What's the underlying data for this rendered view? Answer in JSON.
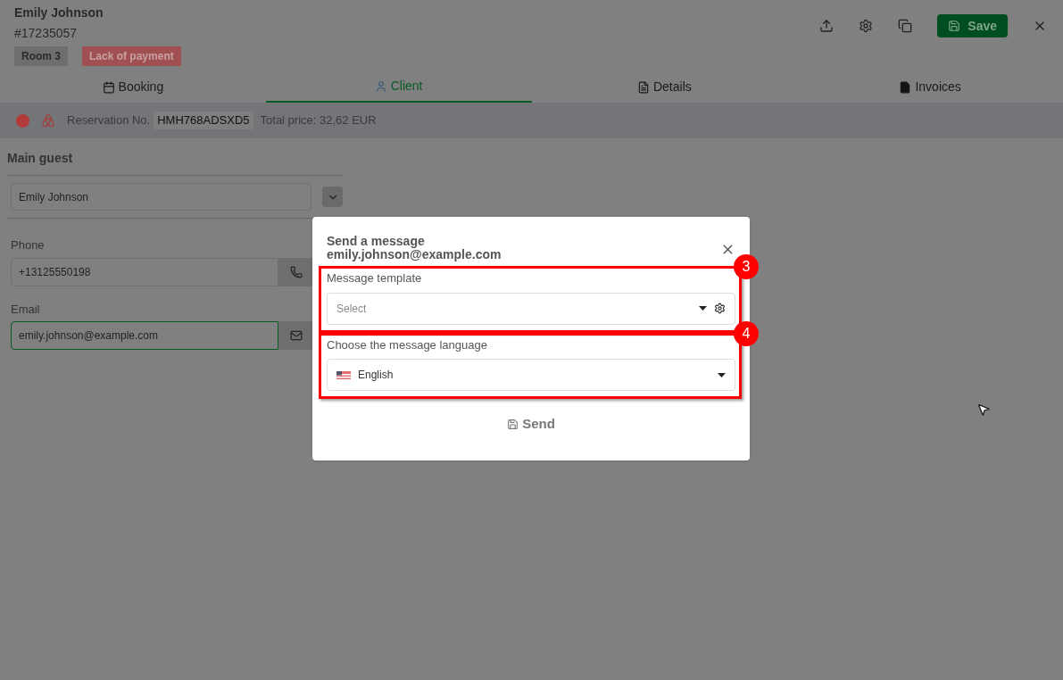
{
  "header": {
    "name": "Emily Johnson",
    "number": "#17235057",
    "badges": [
      {
        "text": "Room 3",
        "kind": "room"
      },
      {
        "text": "Lack of payment",
        "kind": "alert"
      }
    ],
    "save": "Save"
  },
  "tabs": [
    {
      "label": "Booking",
      "selected": false
    },
    {
      "label": "Client",
      "selected": true
    },
    {
      "label": "Details",
      "selected": false
    },
    {
      "label": "Invoices",
      "selected": false
    }
  ],
  "reservation": {
    "label": "Reservation No.",
    "code": "HMH768ADSXD5",
    "total": "Total price: 32,62 EUR"
  },
  "main_guest": {
    "title": "Main guest",
    "guest": "Emily Johnson",
    "phone_label": "Phone",
    "phone": "+13125550198",
    "email_label": "Email",
    "email": "emily.johnson@example.com"
  },
  "modal": {
    "title": "Send a message",
    "recipient": "emily.johnson@example.com",
    "fields": [
      {
        "label": "Message template",
        "placeholder": "Select",
        "kind": "template",
        "callout": "3"
      },
      {
        "label": "Choose the message language",
        "value": "English",
        "kind": "language",
        "callout": "4"
      }
    ],
    "send": "Send"
  }
}
